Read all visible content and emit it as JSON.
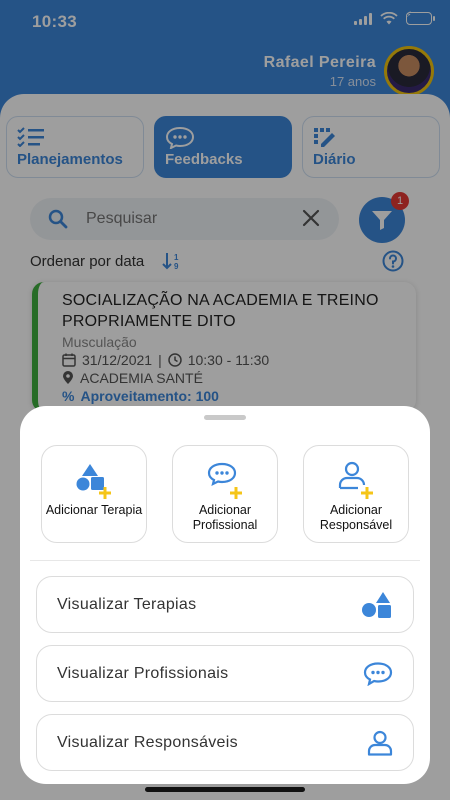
{
  "status_bar": {
    "time": "10:33"
  },
  "user": {
    "name": "Rafael Pereira",
    "age": "17 anos"
  },
  "tabs": [
    {
      "label": "Planejamentos",
      "icon": "checklist-icon",
      "active": false
    },
    {
      "label": "Feedbacks",
      "icon": "chat-bubble-icon",
      "active": true
    },
    {
      "label": "Diário",
      "icon": "pencil-grid-icon",
      "active": false
    }
  ],
  "search": {
    "placeholder": "Pesquisar",
    "filter_badge": "1"
  },
  "sort": {
    "label": "Ordenar por data"
  },
  "card": {
    "title": "SOCIALIZAÇÃO NA ACADEMIA E TREINO PROPRIAMENTE DITO",
    "category": "Musculação",
    "date": "31/12/2021",
    "separator": "|",
    "time": "10:30 - 11:30",
    "location": "ACADEMIA SANTÉ",
    "score": "Aproveitamento: 100",
    "accent_color": "#3fae3f"
  },
  "modal": {
    "grid_buttons": [
      {
        "label": "Adicionar Terapia",
        "icon": "shapes-plus-icon"
      },
      {
        "label": "Adicionar Profissional",
        "icon": "chat-plus-icon"
      },
      {
        "label": "Adicionar Responsável",
        "icon": "person-plus-icon"
      }
    ],
    "list_buttons": [
      {
        "label": "Visualizar Terapias",
        "icon": "shapes-icon"
      },
      {
        "label": "Visualizar Profissionais",
        "icon": "chat-bubble-icon"
      },
      {
        "label": "Visualizar Responsáveis",
        "icon": "person-icon"
      }
    ]
  },
  "colors": {
    "primary": "#3c86d9",
    "plus_accent": "#f5c518",
    "badge": "#e53935"
  }
}
